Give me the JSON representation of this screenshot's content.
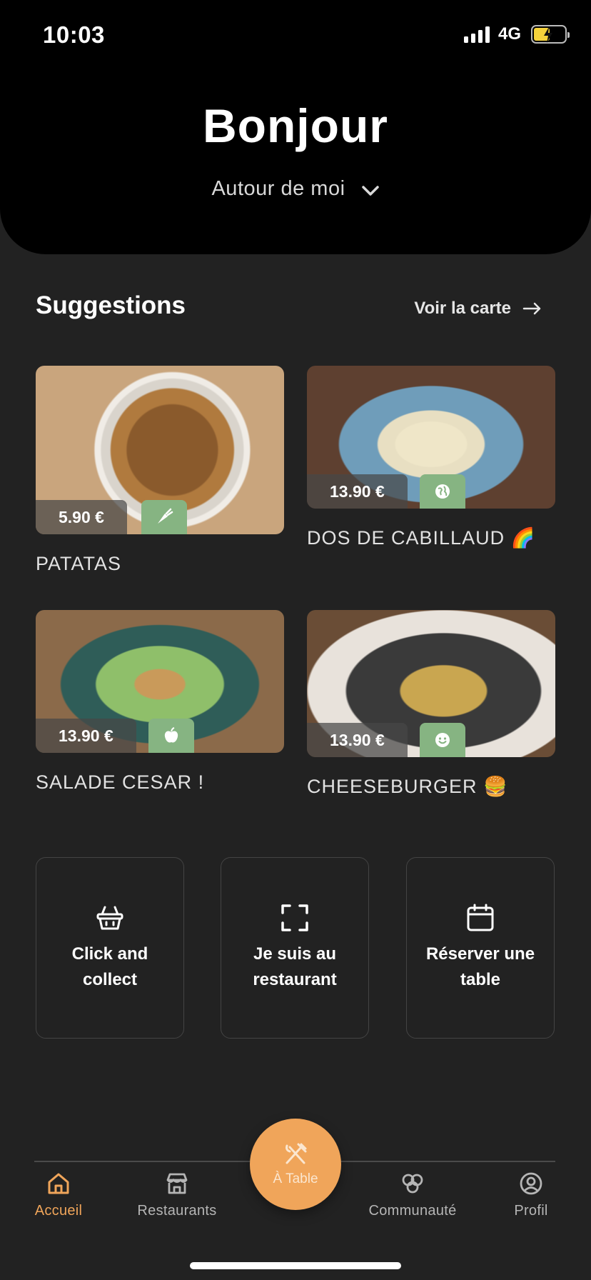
{
  "status": {
    "time": "10:03",
    "network": "4G"
  },
  "header": {
    "greeting": "Bonjour",
    "location": "Autour de moi"
  },
  "suggestions": {
    "title": "Suggestions",
    "see_menu": "Voir la carte",
    "items": [
      {
        "name": "PATATAS",
        "price": "5.90 €",
        "tag_icon": "carrot-icon"
      },
      {
        "name": "DOS DE CABILLAUD 🌈",
        "price": "13.90 €",
        "tag_icon": "globe-icon"
      },
      {
        "name": "SALADE CESAR !",
        "price": "13.90 €",
        "tag_icon": "apple-icon"
      },
      {
        "name": "CHEESEBURGER 🍔",
        "price": "13.90 €",
        "tag_icon": "smiley-icon"
      }
    ]
  },
  "actions": [
    {
      "label": "Click and collect",
      "icon": "basket-icon"
    },
    {
      "label": "Je suis au restaurant",
      "icon": "scan-icon"
    },
    {
      "label": "Réserver une table",
      "icon": "calendar-icon"
    }
  ],
  "nav": {
    "items": [
      {
        "label": "Accueil",
        "icon": "home-icon",
        "active": true
      },
      {
        "label": "Restaurants",
        "icon": "store-icon",
        "active": false
      },
      {
        "label": "Communauté",
        "icon": "community-icon",
        "active": false
      },
      {
        "label": "Profil",
        "icon": "profile-icon",
        "active": false
      }
    ],
    "fab_label": "À Table"
  },
  "colors": {
    "accent": "#f0a55a",
    "tag_green": "#86b482",
    "background": "#222222",
    "header": "#000000"
  }
}
